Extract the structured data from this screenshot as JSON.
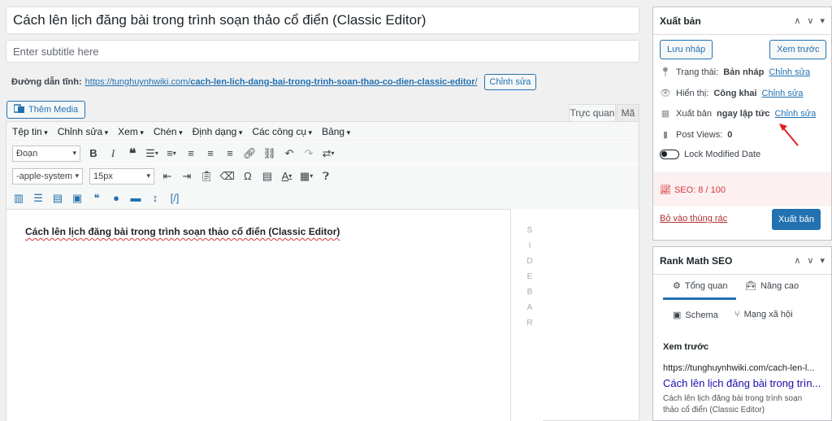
{
  "post": {
    "title": "Cách lên lịch đăng bài trong trình soạn thảo cổ điển (Classic Editor)",
    "subtitle_placeholder": "Enter subtitle here",
    "permalink_label": "Đường dẫn tĩnh:",
    "permalink_base": "https://tunghuynhwiki.com/",
    "permalink_slug": "cach-len-lich-dang-bai-trong-trinh-soan-thao-co-dien-classic-editor",
    "permalink_trailing": "/",
    "permalink_edit": "Chỉnh sửa"
  },
  "editor": {
    "add_media": "Thêm Media",
    "tab_visual": "Trực quan",
    "tab_text": "Mã",
    "menus": [
      "Tệp tin",
      "Chỉnh sửa",
      "Xem",
      "Chèn",
      "Định dạng",
      "Các công cụ",
      "Bảng"
    ],
    "format_select": "Đoạn",
    "font_select": "-apple-system",
    "size_select": "15px",
    "content": "Cách lên lịch đăng bài trong trình soạn thảo cổ điển (Classic Editor)",
    "sidebar_letters": [
      "S",
      "I",
      "D",
      "E",
      "B",
      "A",
      "R"
    ]
  },
  "publish": {
    "title": "Xuất bản",
    "save_draft": "Lưu nháp",
    "preview": "Xem trước",
    "status_label": "Trạng thái:",
    "status_value": "Bản nháp",
    "status_edit": "Chỉnh sửa",
    "visibility_label": "Hiển thị:",
    "visibility_value": "Công khai",
    "visibility_edit": "Chỉnh sửa",
    "schedule_label": "Xuất bản",
    "schedule_value": "ngay lập tức",
    "schedule_edit": "Chỉnh sửa",
    "views_label": "Post Views:",
    "views_value": "0",
    "lock_label": "Lock Modified Date",
    "seo_label": "SEO: 8 / 100",
    "trash": "Bỏ vào thùng rác",
    "publish_button": "Xuất bản"
  },
  "rankmath": {
    "title": "Rank Math SEO",
    "tab_general": "Tổng quan",
    "tab_advanced": "Nâng cao",
    "tab_schema": "Schema",
    "tab_social": "Mạng xã hội",
    "preview_label": "Xem trước",
    "preview_url": "https://tunghuynhwiki.com/cach-len-l...",
    "preview_title": "Cách lên lịch đăng bài trong trìn...",
    "preview_desc": "Cách lên lịch đăng bài trong trình soạn thảo cổ điển (Classic Editor)"
  },
  "colors": {
    "accent": "#2271b1",
    "annotation_arrow": "#e02020",
    "seo_red": "#d63638"
  }
}
